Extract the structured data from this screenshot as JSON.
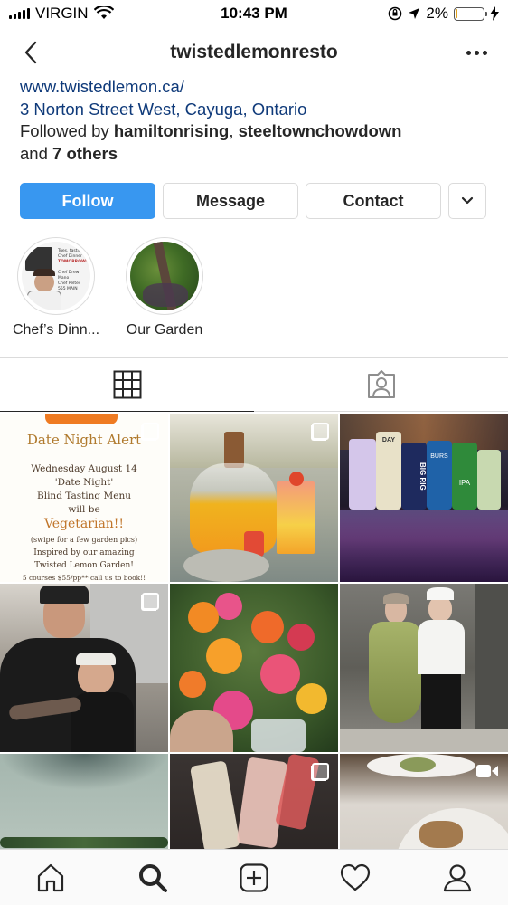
{
  "status_bar": {
    "carrier": "VIRGIN",
    "time": "10:43 PM",
    "battery": "2%",
    "battery_level": 0.02
  },
  "header": {
    "username": "twistedlemonresto"
  },
  "bio": {
    "website": "www.twistedlemon.ca/",
    "address": "3 Norton Street West, Cayuga, Ontario",
    "followed_prefix": "Followed by",
    "follower_1": "hamiltonrising",
    "separator": ",",
    "follower_2": "steeltownchowdown",
    "and_text": "and",
    "others": "7 others"
  },
  "buttons": {
    "follow": "Follow",
    "message": "Message",
    "contact": "Contact"
  },
  "highlights": [
    {
      "label": "Chef’s Dinn..."
    },
    {
      "label": "Our Garden"
    }
  ],
  "story_text": {
    "line1": "Tues. tasting",
    "line2": "Chef Dinner",
    "line3": "TOMORROW!",
    "line4": "Chef Drew Mano",
    "line5": "Chef Peltes",
    "line6": "555 MAIN"
  },
  "grid": {
    "poster": {
      "title": "Date Night Alert",
      "l1": "Wednesday August 14",
      "l2": "'Date Night'",
      "l3": "Blind Tasting Menu",
      "l4": "will be",
      "big": "Vegetarian!!",
      "l5": "(swipe for a few garden pics)",
      "l6": "Inspired by our amazing",
      "l7": "Twisted Lemon Garden!",
      "l8": "5 courses $55/pp** call us to book!!"
    },
    "cans": [
      "DAY",
      "BIG RIG",
      "BURS",
      "IPA"
    ]
  },
  "colors": {
    "follow_blue": "#3897f0",
    "link": "#0f3a7a",
    "border": "#dbdbdb",
    "text": "#262626"
  },
  "icons": {
    "back": "chevron-left-icon",
    "more": "ellipsis-icon",
    "grid_tab": "grid-icon",
    "tagged_tab": "tagged-person-icon",
    "home": "home-icon",
    "search": "search-icon",
    "add": "add-post-icon",
    "activity": "heart-icon",
    "profile": "profile-icon"
  }
}
